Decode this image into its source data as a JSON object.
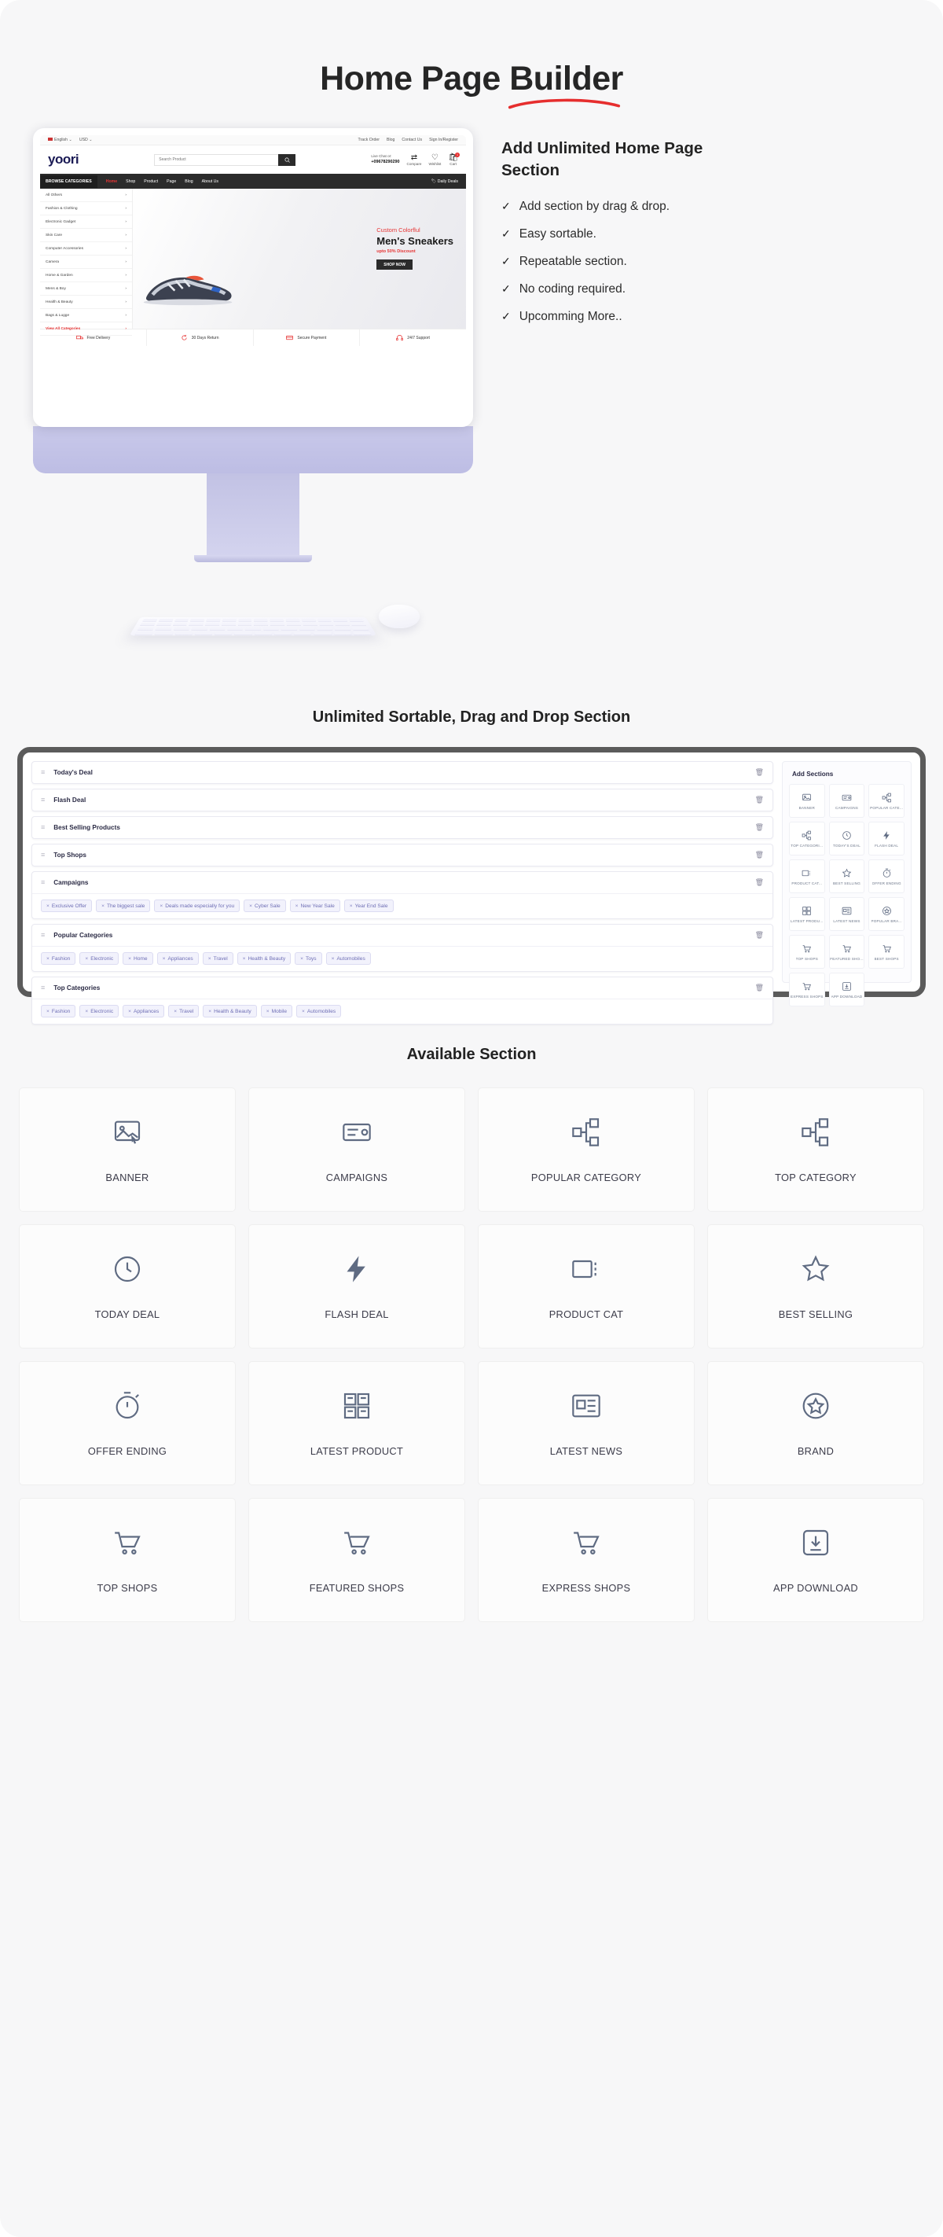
{
  "hero": {
    "title_prefix": "Home Page ",
    "title_highlight": "Builder",
    "subtitle": "Add Unlimited Home Page Section",
    "features": [
      "Add section by drag & drop.",
      "Easy sortable.",
      "Repeatable section.",
      "No coding required.",
      "Upcomming More.."
    ],
    "tick_glyph": "✓",
    "accent_red": "#e62e2e"
  },
  "mock": {
    "topbar": {
      "language": "English",
      "currency": "USD",
      "links": [
        "Track Order",
        "Blog",
        "Contact Us",
        "Sign In/Register"
      ],
      "chevron": "⌄"
    },
    "brand": "yoori",
    "search_placeholder": "Search Product",
    "search_icon": "⚲",
    "live_chat_label": "Live Chat or:",
    "phone": "+09678290290",
    "actions": [
      {
        "label": "Compare",
        "icon": "⇄"
      },
      {
        "label": "Wishlist",
        "icon": "♡"
      },
      {
        "label": "Cart",
        "icon": "Ὤd",
        "badge": "1"
      }
    ],
    "nav": {
      "browse": "BROWSE CATEGORIES",
      "items": [
        "Home",
        "Shop",
        "Product",
        "Page",
        "Blog",
        "About Us"
      ],
      "daily_deals": "Daily Deals"
    },
    "sidebar": [
      "All Others",
      "Fashion & Clothing",
      "Electronic Gadget",
      "Skin Care",
      "Computer Accessories",
      "Camera",
      "Home & Garden",
      "Mens & Boy",
      "Health & Beauty",
      "Bags & Lugge",
      "View All Categories"
    ],
    "banner": {
      "line1_plain": "Custom ",
      "line1_accent": "Colorflul",
      "line2": "Men's Sneakers",
      "line3_plain": "upto 50% ",
      "line3_accent": "Discount",
      "cta": "SHOP NOW"
    },
    "features": [
      "Free Delivery",
      "30 Days Return",
      "Secure Payment",
      "24/7 Support"
    ]
  },
  "builder": {
    "title": "Unlimited Sortable, Drag and Drop Section",
    "drag_handle_glyph": "≡",
    "trash_glyph": "Ὕ1",
    "tag_close_glyph": "×",
    "sections": [
      {
        "name": "Today's Deal",
        "tags": []
      },
      {
        "name": "Flash Deal",
        "tags": []
      },
      {
        "name": "Best Selling Products",
        "tags": []
      },
      {
        "name": "Top Shops",
        "tags": []
      },
      {
        "name": "Campaigns",
        "tags": [
          "Exclusive Offer",
          "The biggest sale",
          "Deals made especially for you",
          "Cyber Sale",
          "New Year Sale",
          "Year End Sale"
        ]
      },
      {
        "name": "Popular Categories",
        "tags": [
          "Fashion",
          "Electronic",
          "Home",
          "Appliances",
          "Travel",
          "Health & Beauty",
          "Toys",
          "Automobiles"
        ]
      },
      {
        "name": "Top Categories",
        "tags": [
          "Fashion",
          "Electronic",
          "Appliances",
          "Travel",
          "Health & Beauty",
          "Mobile",
          "Automobiles"
        ]
      }
    ],
    "add_panel": {
      "title": "Add Sections",
      "items": [
        {
          "label": "BANNER",
          "icon": "banner-icon"
        },
        {
          "label": "CAMPAIGNS",
          "icon": "campaigns-icon"
        },
        {
          "label": "POPULAR CATE...",
          "icon": "popular-category-icon"
        },
        {
          "label": "TOP CATEGORI...",
          "icon": "top-category-icon"
        },
        {
          "label": "TODAY'S DEAL",
          "icon": "today-deal-icon"
        },
        {
          "label": "FLASH DEAL",
          "icon": "flash-deal-icon"
        },
        {
          "label": "PRODUCT CAT...",
          "icon": "product-cat-icon"
        },
        {
          "label": "BEST SELLING",
          "icon": "best-selling-icon"
        },
        {
          "label": "OFFER ENDING",
          "icon": "offer-ending-icon"
        },
        {
          "label": "LATEST PRODU...",
          "icon": "latest-product-icon"
        },
        {
          "label": "LATEST NEWS",
          "icon": "latest-news-icon"
        },
        {
          "label": "POPULAR BRA...",
          "icon": "brand-icon"
        },
        {
          "label": "TOP SHOPS",
          "icon": "top-shops-icon"
        },
        {
          "label": "FEATURED SHO...",
          "icon": "featured-shops-icon"
        },
        {
          "label": "BEST SHOPS",
          "icon": "best-shops-icon"
        },
        {
          "label": "EXPRESS SHOPS",
          "icon": "express-shops-icon"
        },
        {
          "label": "APP DOWNLOAD",
          "icon": "app-download-icon"
        }
      ]
    }
  },
  "available": {
    "title": "Available Section",
    "items": [
      {
        "label": "BANNER",
        "icon": "banner-icon"
      },
      {
        "label": "CAMPAIGNS",
        "icon": "campaigns-icon"
      },
      {
        "label": "POPULAR CATEGORY",
        "icon": "popular-category-icon"
      },
      {
        "label": "TOP CATEGORY",
        "icon": "top-category-icon"
      },
      {
        "label": "TODAY DEAL",
        "icon": "today-deal-icon"
      },
      {
        "label": "FLASH DEAL",
        "icon": "flash-deal-icon"
      },
      {
        "label": "PRODUCT CAT",
        "icon": "product-cat-icon"
      },
      {
        "label": "BEST SELLING",
        "icon": "best-selling-icon"
      },
      {
        "label": "OFFER ENDING",
        "icon": "offer-ending-icon"
      },
      {
        "label": "LATEST PRODUCT",
        "icon": "latest-product-icon"
      },
      {
        "label": "LATEST NEWS",
        "icon": "latest-news-icon"
      },
      {
        "label": "BRAND",
        "icon": "brand-icon"
      },
      {
        "label": "TOP SHOPS",
        "icon": "top-shops-icon"
      },
      {
        "label": "FEATURED SHOPS",
        "icon": "featured-shops-icon"
      },
      {
        "label": "EXPRESS SHOPS",
        "icon": "express-shops-icon"
      },
      {
        "label": "APP DOWNLOAD",
        "icon": "app-download-icon"
      }
    ]
  }
}
